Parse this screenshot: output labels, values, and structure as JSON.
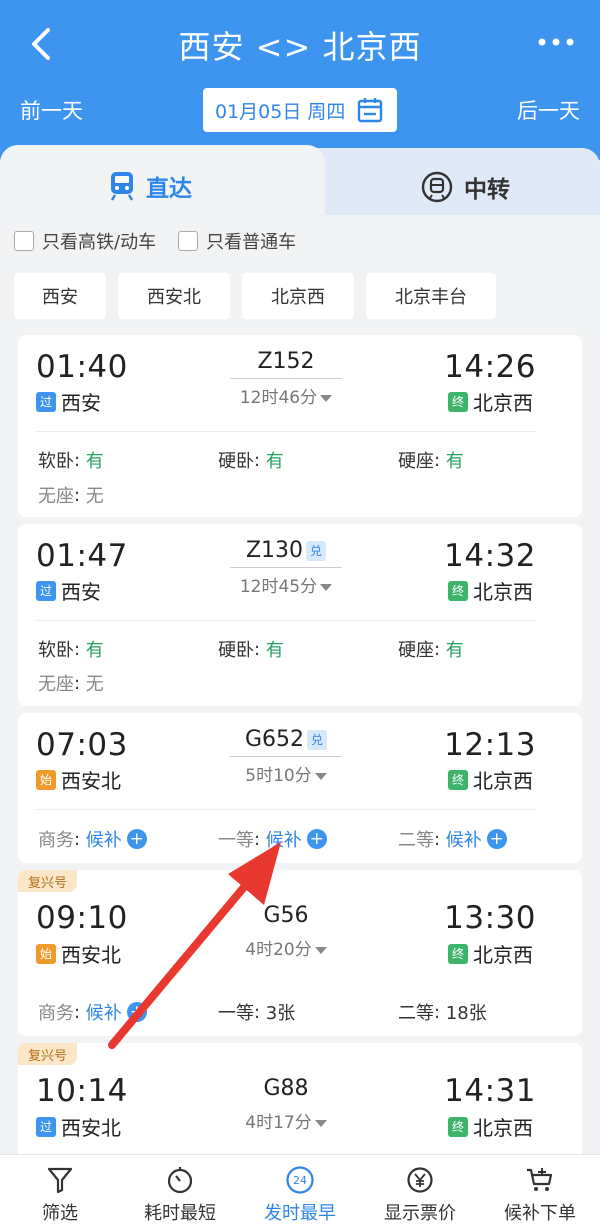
{
  "header": {
    "title": "西安 <> 北京西",
    "prev_day": "前一天",
    "next_day": "后一天",
    "date": "01月05日 周四"
  },
  "tabs": {
    "direct": "直达",
    "transfer": "中转"
  },
  "filters": {
    "high_speed_only": "只看高铁/动车",
    "regular_only": "只看普通车",
    "stations": [
      "西安",
      "西安北",
      "北京西",
      "北京丰台"
    ]
  },
  "trains": [
    {
      "dep_time": "01:40",
      "dep_tag": "过",
      "dep_station": "西安",
      "train_no": "Z152",
      "badge": "",
      "duration": "12时46分",
      "arr_time": "14:26",
      "arr_tag": "终",
      "arr_station": "北京西",
      "seats": [
        {
          "name": "软卧",
          "value": "有"
        },
        {
          "name": "硬卧",
          "value": "有"
        },
        {
          "name": "硬座",
          "value": "有"
        },
        {
          "name": "无座",
          "value": "无"
        }
      ]
    },
    {
      "dep_time": "01:47",
      "dep_tag": "过",
      "dep_station": "西安",
      "train_no": "Z130",
      "badge": "兑",
      "duration": "12时45分",
      "arr_time": "14:32",
      "arr_tag": "终",
      "arr_station": "北京西",
      "seats": [
        {
          "name": "软卧",
          "value": "有"
        },
        {
          "name": "硬卧",
          "value": "有"
        },
        {
          "name": "硬座",
          "value": "有"
        },
        {
          "name": "无座",
          "value": "无"
        }
      ]
    },
    {
      "dep_time": "07:03",
      "dep_tag": "始",
      "dep_station": "西安北",
      "train_no": "G652",
      "badge": "兑",
      "duration": "5时10分",
      "arr_time": "12:13",
      "arr_tag": "终",
      "arr_station": "北京西",
      "seats": [
        {
          "name": "商务",
          "value": "候补"
        },
        {
          "name": "一等",
          "value": "候补"
        },
        {
          "name": "二等",
          "value": "候补"
        }
      ]
    },
    {
      "label": "复兴号",
      "dep_time": "09:10",
      "dep_tag": "始",
      "dep_station": "西安北",
      "train_no": "G56",
      "badge": "",
      "duration": "4时20分",
      "arr_time": "13:30",
      "arr_tag": "终",
      "arr_station": "北京西",
      "seats": [
        {
          "name": "商务",
          "value": "候补"
        },
        {
          "name": "一等",
          "value": "3张"
        },
        {
          "name": "二等",
          "value": "18张"
        }
      ]
    },
    {
      "label": "复兴号",
      "dep_time": "10:14",
      "dep_tag": "过",
      "dep_station": "西安北",
      "train_no": "G88",
      "badge": "",
      "duration": "4时17分",
      "arr_time": "14:31",
      "arr_tag": "终",
      "arr_station": "北京西",
      "seats": []
    }
  ],
  "bottom_bar": [
    {
      "label": "筛选",
      "icon": "filter-icon"
    },
    {
      "label": "耗时最短",
      "icon": "stopwatch-icon"
    },
    {
      "label": "发时最早",
      "icon": "clock-24-icon",
      "badge": "24"
    },
    {
      "label": "显示票价",
      "icon": "yuan-icon"
    },
    {
      "label": "候补下单",
      "icon": "cart-plus-icon"
    }
  ],
  "colors": {
    "brand_blue": "#3d95f0",
    "green": "#27a063",
    "link_blue": "#2f86e9",
    "annotation_red": "#e8382f"
  }
}
